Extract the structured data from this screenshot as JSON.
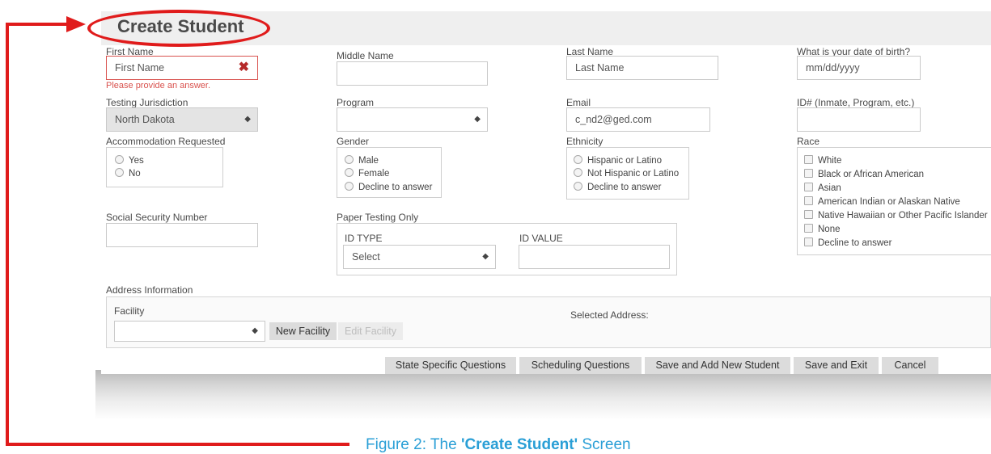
{
  "form": {
    "title": "Create Student",
    "first_name": {
      "label": "First Name",
      "value": "First Name",
      "error": "Please provide an answer."
    },
    "middle_name": {
      "label": "Middle Name",
      "value": ""
    },
    "last_name": {
      "label": "Last Name",
      "placeholder": "Last Name"
    },
    "dob": {
      "label": "What is your date of birth?",
      "placeholder": "mm/dd/yyyy"
    },
    "testing_jurisdiction": {
      "label": "Testing Jurisdiction",
      "value": "North Dakota"
    },
    "program": {
      "label": "Program",
      "value": ""
    },
    "email": {
      "label": "Email",
      "value": "c_nd2@ged.com"
    },
    "id_number": {
      "label": "ID# (Inmate, Program, etc.)",
      "value": ""
    },
    "accommodation": {
      "label": "Accommodation Requested",
      "options": [
        "Yes",
        "No"
      ]
    },
    "gender": {
      "label": "Gender",
      "options": [
        "Male",
        "Female",
        "Decline to answer"
      ]
    },
    "ethnicity": {
      "label": "Ethnicity",
      "options": [
        "Hispanic or Latino",
        "Not Hispanic or Latino",
        "Decline to answer"
      ]
    },
    "race": {
      "label": "Race",
      "options": [
        "White",
        "Black or African American",
        "Asian",
        "American Indian or Alaskan Native",
        "Native Hawaiian or Other Pacific Islander",
        "None",
        "Decline to answer"
      ]
    },
    "ssn": {
      "label": "Social Security Number",
      "value": ""
    },
    "paper_testing": {
      "label": "Paper Testing Only",
      "id_type_label": "ID TYPE",
      "id_type_value": "Select",
      "id_value_label": "ID VALUE",
      "id_value": ""
    },
    "address": {
      "label": "Address Information",
      "facility_label": "Facility",
      "facility_value": "",
      "new_facility": "New Facility",
      "edit_facility": "Edit Facility",
      "selected_address": "Selected Address:"
    },
    "buttons": {
      "state_specific": "State Specific Questions",
      "scheduling": "Scheduling Questions",
      "save_add": "Save and Add New Student",
      "save_exit": "Save and Exit",
      "cancel": "Cancel"
    }
  },
  "caption": {
    "prefix": "Figure 2: The ",
    "emph": "'Create Student'",
    "suffix": " Screen"
  },
  "colors": {
    "accent_red": "#e01b1b",
    "caption_blue": "#2a9fd6",
    "error_red": "#d9534f"
  },
  "icons": {
    "error": "x-icon",
    "select": "sort-arrows-icon"
  }
}
